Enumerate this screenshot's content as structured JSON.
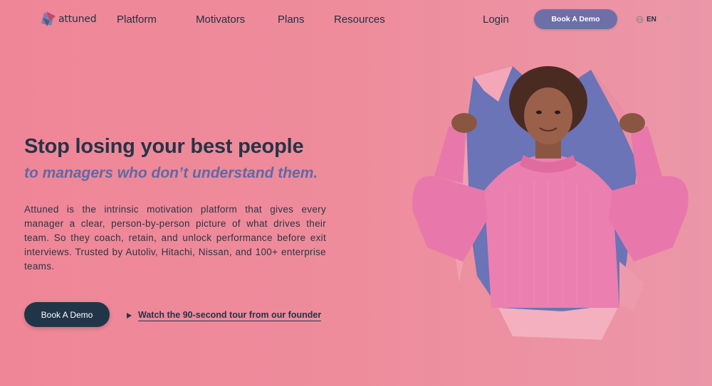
{
  "brand": {
    "name": "attuned",
    "logo_icon": "attuned-logo-mark",
    "colors": {
      "accent": "#6f6fa8",
      "dark": "#213548",
      "background": "#ef8697",
      "headline": "#253447",
      "subheadline": "#5d6aa6"
    }
  },
  "nav": {
    "items": [
      "Platform",
      "Motivators",
      "Plans",
      "Resources"
    ],
    "login": "Login",
    "book_demo": "Book A Demo",
    "language": {
      "icon": "globe-icon",
      "active": "EN",
      "separator": "/",
      "other": "JP"
    }
  },
  "hero": {
    "headline": "Stop losing your best people",
    "subheadline": "to managers who don’t understand them.",
    "body": "Attuned is the intrinsic motivation platform that gives every manager a clear, person-by-person picture of what drives their team. So they coach, retain, and unlock performance before exit interviews. Trusted by Autoliv, Hitachi, Nissan, and 100+ enterprise teams.",
    "cta_button": "Book A Demo",
    "video_link": {
      "icon": "play-icon",
      "label": "Watch the 90-second tour from our founder"
    },
    "image": "woman-in-pink-sweater-flexing-through-torn-paper"
  }
}
